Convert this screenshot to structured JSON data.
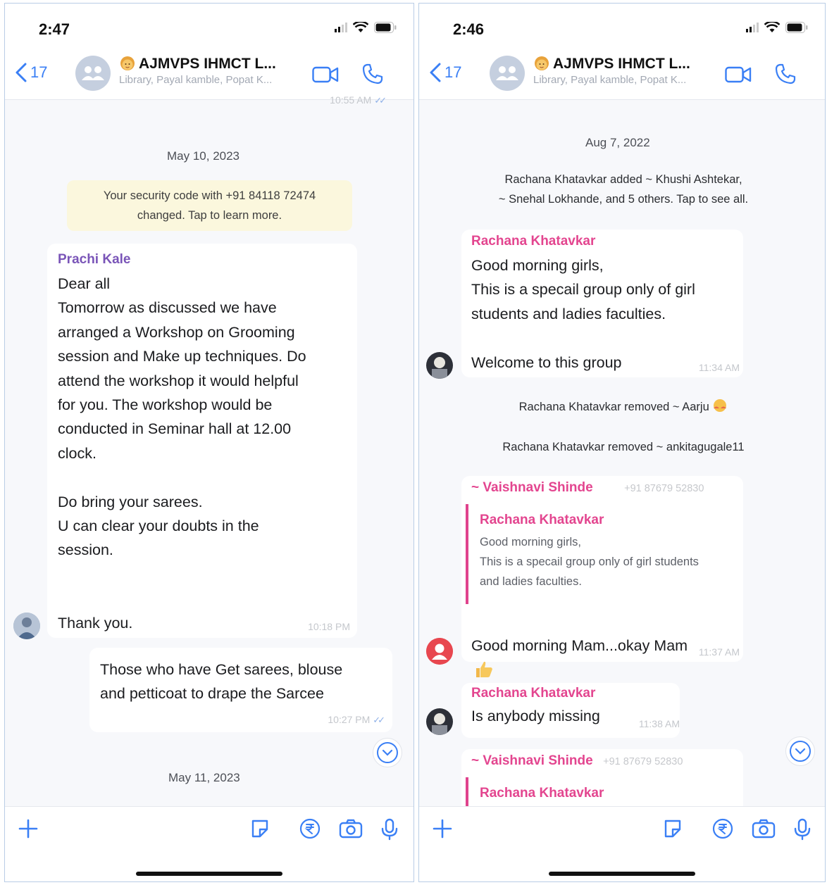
{
  "left": {
    "status": {
      "time": "2:47"
    },
    "header": {
      "back_count": "17",
      "title": "AJMVPS  IHMCT L...",
      "subtitle": "Library, Payal kamble, Popat K..."
    },
    "top_clipped_time": "10:55 AM",
    "date_1": "May 10, 2023",
    "security_notice": "Your security code with +91 84118 72474\nchanged. Tap to learn more.",
    "message_1": {
      "sender": "Prachi Kale",
      "text": "Dear all\nTomorrow as discussed we have\narranged a Workshop on Grooming\nsession and Make up techniques. Do\nattend the workshop it would helpful\nfor you. The workshop would be\nconducted in Seminar hall at 12.00\nclock.\n\nDo bring your sarees.\nU can clear your doubts in the\nsession.\n\n\nThank you.",
      "time": "10:18 PM"
    },
    "message_2": {
      "text": "Those who have Get sarees, blouse\nand petticoat to drape the Sarcee",
      "time": "10:27 PM"
    },
    "date_2": "May 11, 2023"
  },
  "right": {
    "status": {
      "time": "2:46"
    },
    "header": {
      "back_count": "17",
      "title": "AJMVPS  IHMCT L...",
      "subtitle": "Library, Payal kamble, Popat K..."
    },
    "date_1": "Aug 7, 2022",
    "system_added": "Rachana Khatavkar added ~ Khushi Ashtekar,\n~ Snehal Lokhande, and 5 others. Tap to see all.",
    "message_1": {
      "sender": "Rachana Khatavkar",
      "text": "Good morning girls,\nThis is a specail group only of girl\nstudents and ladies faculties.\n\nWelcome to this group",
      "time": "11:34 AM"
    },
    "system_removed_1": "Rachana Khatavkar removed ~ Aarju",
    "system_removed_2": "Rachana Khatavkar removed ~ ankitagugale11",
    "message_2": {
      "sender": "~ Vaishnavi Shinde",
      "phone": "+91 87679 52830",
      "quote_sender": "Rachana Khatavkar",
      "quote_text": "Good morning girls,\nThis is a specail group only of girl students\nand ladies faculties.",
      "text": "Good morning Mam...okay Mam",
      "time": "11:37 AM"
    },
    "message_3": {
      "sender": "Rachana Khatavkar",
      "text": "Is anybody missing",
      "time": "11:38 AM"
    },
    "message_4": {
      "sender": "~ Vaishnavi Shinde",
      "phone": "+91 87679 52830",
      "quote_sender": "Rachana Khatavkar"
    }
  },
  "colors": {
    "accent": "#3a7ff5",
    "sender_pink": "#e3458f",
    "sender_purple": "#7a55b8",
    "security_bg": "#fbf7dd"
  }
}
